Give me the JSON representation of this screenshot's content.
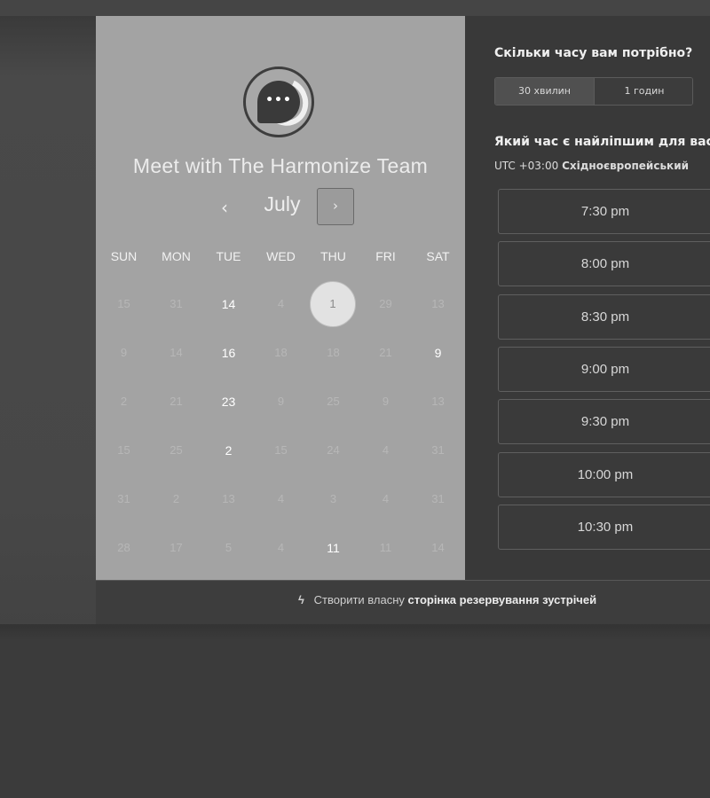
{
  "calendar": {
    "title": "Meet with The Harmonize Team",
    "month": "July",
    "prev_icon": "‹",
    "next_icon": "›",
    "weekdays": [
      "SUN",
      "MON",
      "TUE",
      "WED",
      "THU",
      "FRI",
      "SAT"
    ],
    "weeks": [
      [
        "15",
        "31",
        "14",
        "4",
        "1",
        "29",
        "13"
      ],
      [
        "9",
        "14",
        "16",
        "18",
        "18",
        "21",
        "9"
      ],
      [
        "2",
        "21",
        "23",
        "9",
        "25",
        "9",
        "13"
      ],
      [
        "15",
        "25",
        "2",
        "15",
        "24",
        "4",
        "31"
      ],
      [
        "31",
        "2",
        "13",
        "4",
        "3",
        "4",
        "31"
      ],
      [
        "28",
        "17",
        "5",
        "4",
        "11",
        "11",
        "14"
      ]
    ],
    "selected_day": "1"
  },
  "booking": {
    "duration_question": "Скільки часу вам потрібно?",
    "duration_options": [
      "30 хвилин",
      "1 годин"
    ],
    "selected_duration": "30 хвилин",
    "best_time_question": "Який час є найліпшим для вас",
    "timezone_offset": "UTC +03:00",
    "timezone_name": "Східноєвропейський",
    "time_slots": [
      "7:30 pm",
      "8:00 pm",
      "8:30 pm",
      "9:00 pm",
      "9:30 pm",
      "10:00 pm",
      "10:30 pm"
    ]
  },
  "footer": {
    "prefix": "Створити власну",
    "bold": "сторінка резервування зустрічей",
    "icon": "hubspot-icon"
  }
}
